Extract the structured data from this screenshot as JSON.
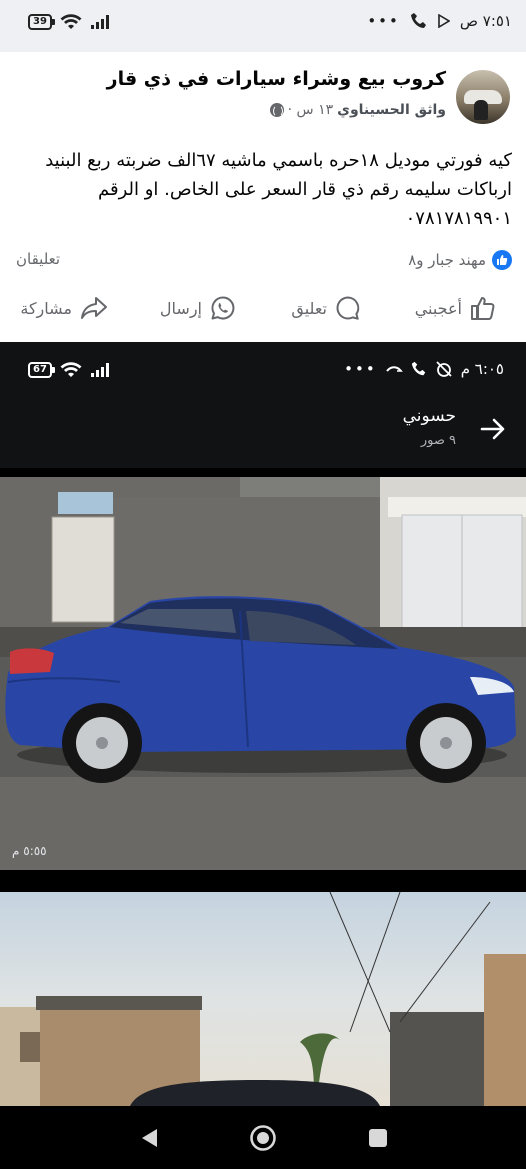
{
  "status_bar_top": {
    "time": "٧:٥١ ص",
    "battery": "39",
    "dots": "•••"
  },
  "post": {
    "group_name": "كروب بيع وشراء سيارات في ذي قار",
    "author": "واثق الحسيناوي",
    "time_ago": "١٣ س ·",
    "text_lines": [
      "كيه فورتي موديل ١٨حره باسمي ماشيه ٦٧الف ضربته ربع البنيد",
      "ارباكات سليمه رقم ذي قار السعر على الخاص. او الرقم",
      "٠٧٨١٧٨١٩٩٠١"
    ],
    "reactor": "مهند جبار و٨",
    "comments_count": "تعليقان",
    "actions": {
      "like": "أعجبني",
      "comment": "تعليق",
      "send": "إرسال",
      "share": "مشاركة"
    },
    "colors": {
      "accent": "#1877f2",
      "secondary_text": "#65676b"
    }
  },
  "status_bar_viewer": {
    "time": "٦:٠٥ م",
    "battery": "67",
    "dots": "•••"
  },
  "viewer": {
    "title": "حسوني",
    "subtitle": "٩ صور",
    "photo1_time": "٥:٥٥ م",
    "icons": [
      "arrow-right-icon"
    ]
  },
  "nav": {
    "icons": [
      "back-icon",
      "home-icon",
      "recents-icon"
    ]
  }
}
